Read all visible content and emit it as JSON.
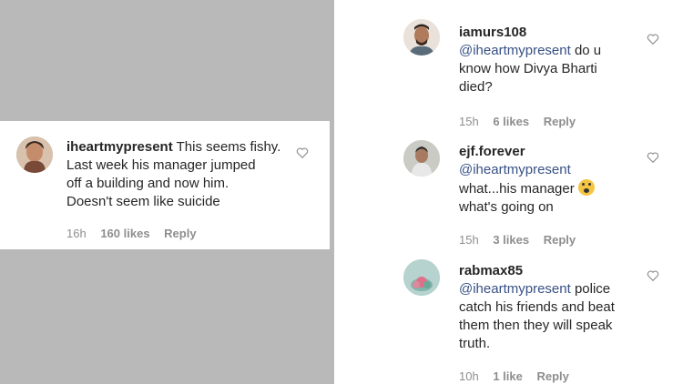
{
  "left_comment": {
    "username": "iheartmypresent",
    "text_line1": " This seems fishy.",
    "text_line2": "Last week his manager jumped",
    "text_line3": "off a building and now him.",
    "text_line4": "Doesn't seem like suicide",
    "time": "16h",
    "likes": "160 likes",
    "reply": "Reply"
  },
  "right_comments": [
    {
      "username": "iamurs108",
      "mention": "@iheartmypresent",
      "text_line1": " do u",
      "text_line2": "know how Divya Bharti",
      "text_line3": "died?",
      "time": "15h",
      "likes": "6 likes",
      "reply": "Reply"
    },
    {
      "username": "ejf.forever",
      "mention": "@iheartmypresent",
      "text_line1": "what...his manager",
      "text_line2": "what's going on",
      "emoji": "face-screaming-emoji",
      "time": "15h",
      "likes": "3 likes",
      "reply": "Reply"
    },
    {
      "username": "rabmax85",
      "mention": "@iheartmypresent",
      "text_line1": " police",
      "text_line2": "catch his friends and beat",
      "text_line3": "them then they will speak",
      "text_line4": "truth.",
      "time": "10h",
      "likes": "1 like",
      "reply": "Reply"
    }
  ],
  "colors": {
    "background_gray": "#b9b9b9",
    "mention_blue": "#385185",
    "meta_gray": "#8e8e8e",
    "text": "#262626"
  }
}
